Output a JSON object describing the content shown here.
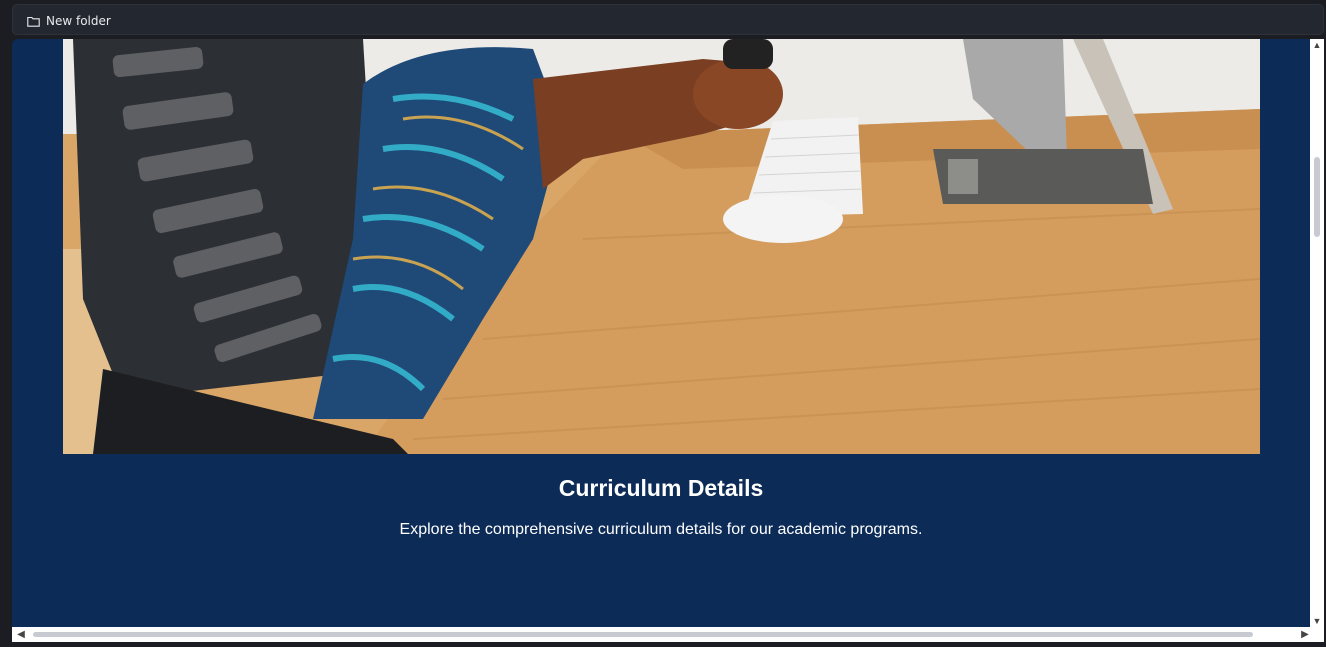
{
  "bookmarks_bar": {
    "items": [
      {
        "label": "New folder",
        "icon": "folder-icon"
      }
    ]
  },
  "page": {
    "hero_image": {
      "icon": "photo",
      "description_semantic": "hero-photo"
    },
    "heading": "Curriculum Details",
    "subtext": "Explore the comprehensive curriculum details for our academic programs."
  },
  "colors": {
    "page_background": "#0c2b57",
    "text": "#ffffff",
    "bookmarks_bar": "#232730"
  }
}
